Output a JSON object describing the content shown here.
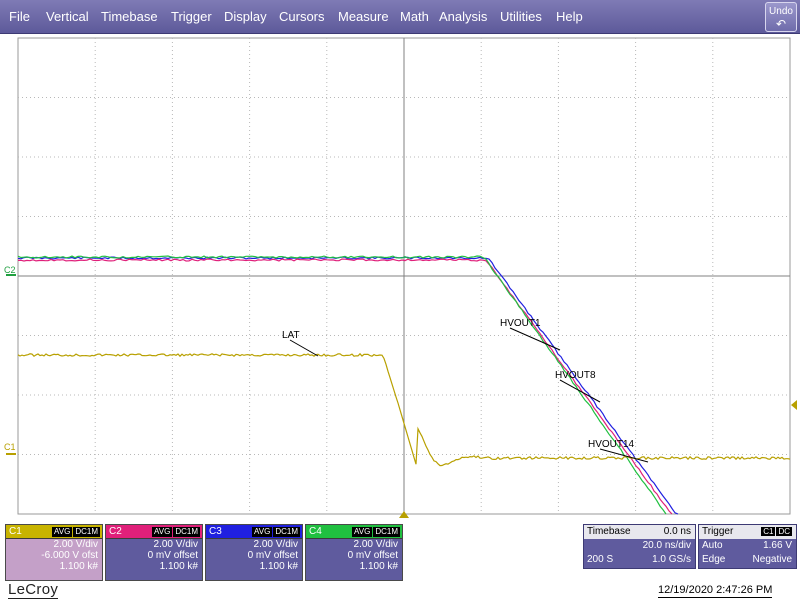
{
  "menu": {
    "items": [
      "File",
      "Vertical",
      "Timebase",
      "Trigger",
      "Display",
      "Cursors",
      "Measure",
      "Math",
      "Analysis",
      "Utilities",
      "Help"
    ],
    "undo_label": "Undo",
    "undo_icon": "undo-arrow-icon"
  },
  "grid": {
    "ch2_marker": "C2",
    "ch1_marker": "C1"
  },
  "labels": {
    "lat": "LAT",
    "hvout1": "HVOUT1",
    "hvout8": "HVOUT8",
    "hvout14": "HVOUT14"
  },
  "channels": [
    {
      "name": "C1",
      "avg": "AVG",
      "coupling": "DC1M",
      "scale": "2.00 V/div",
      "offset": "-6.000 V ofst",
      "count": "1.100 k#",
      "color": "#c4a0c8",
      "text": "#ffffff"
    },
    {
      "name": "C2",
      "avg": "AVG",
      "coupling": "DC1M",
      "scale": "2.00 V/div",
      "offset": "0 mV offset",
      "count": "1.100 k#",
      "color": "#5f5b9e",
      "text": "#ffffff"
    },
    {
      "name": "C3",
      "avg": "AVG",
      "coupling": "DC1M",
      "scale": "2.00 V/div",
      "offset": "0 mV offset",
      "count": "1.100 k#",
      "color": "#5f5b9e",
      "text": "#ffffff"
    },
    {
      "name": "C4",
      "avg": "AVG",
      "coupling": "DC1M",
      "scale": "2.00 V/div",
      "offset": "0 mV offset",
      "count": "1.100 k#",
      "color": "#5f5b9e",
      "text": "#ffffff"
    }
  ],
  "channel_head_colors": [
    "#c8b400",
    "#e0207a",
    "#2020e0",
    "#20c040"
  ],
  "timebase": {
    "title": "Timebase",
    "delay": "0.0 ns",
    "per_div": "20.0 ns/div",
    "samples": "200 S",
    "rate": "1.0 GS/s"
  },
  "trigger": {
    "title": "Trigger",
    "source": "C1",
    "coupling": "DC",
    "mode": "Auto",
    "level": "1.66 V",
    "type": "Edge",
    "slope": "Negative"
  },
  "brand": "LeCroy",
  "datetime": "12/19/2020 2:47:26 PM",
  "trace_colors": {
    "lat": "#b8a000",
    "hvout1": "#e0207a",
    "hvout8": "#2020e0",
    "hvout14": "#20c040"
  }
}
